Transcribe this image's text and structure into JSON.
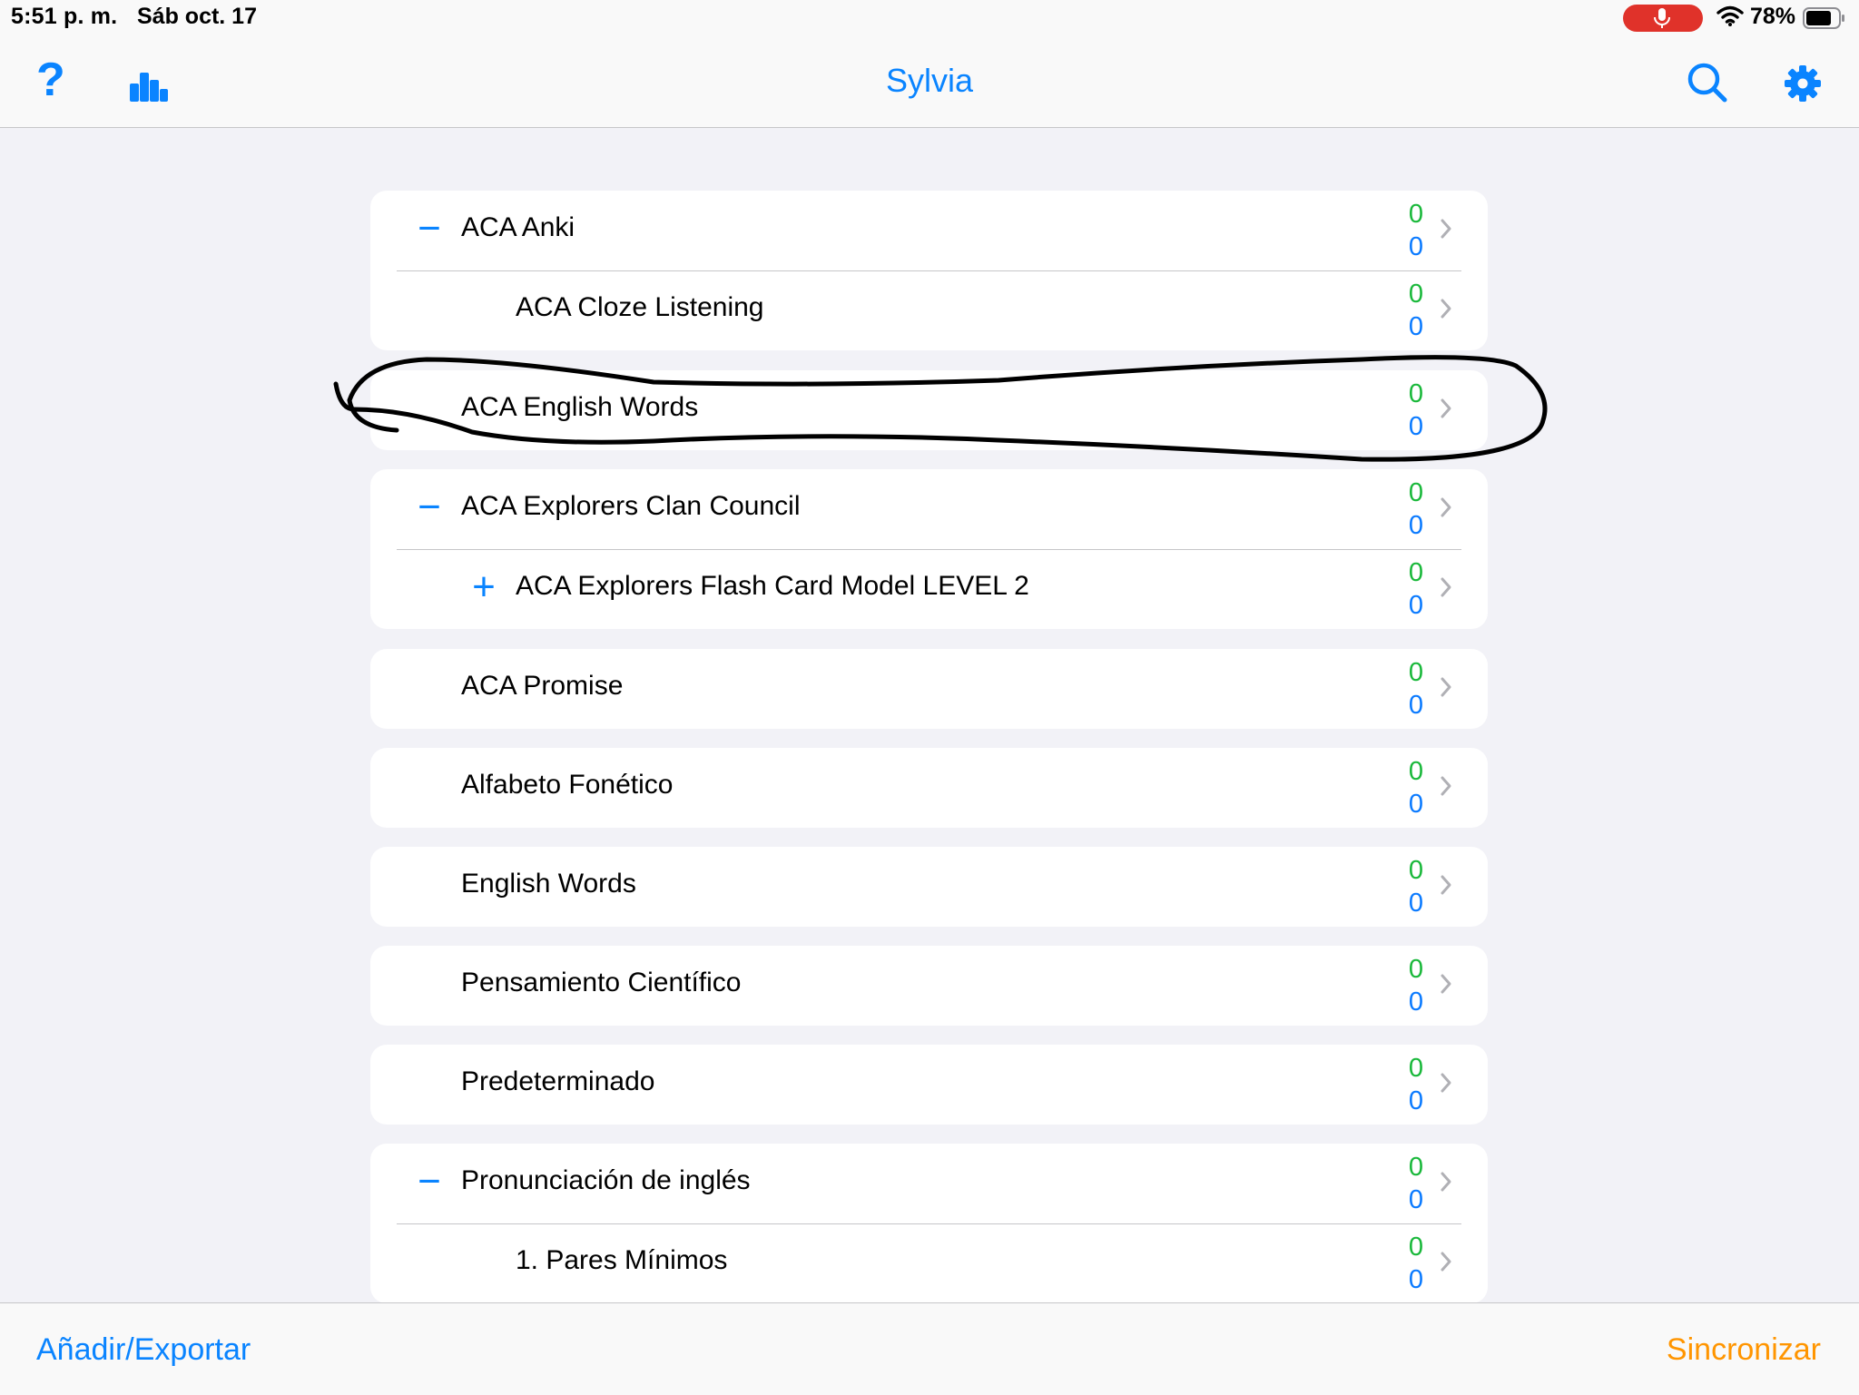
{
  "status_bar": {
    "time": "5:51 p. m.",
    "date": "Sáb oct. 17",
    "battery": "78%",
    "icons": [
      "microphone-icon",
      "wifi-icon",
      "battery-icon"
    ]
  },
  "nav": {
    "title": "Sylvia",
    "help_icon": "?",
    "icons": [
      "help-icon",
      "stats-icon",
      "search-icon",
      "gear-icon"
    ]
  },
  "colors": {
    "accent": "#0a84ff",
    "new_count": "#19b83a",
    "due_count": "#0a7aff",
    "sync": "#ff9500",
    "background": "#f2f2f7"
  },
  "decks": [
    {
      "rows": [
        {
          "name": "ACA Anki",
          "toggle": "−",
          "level": 0,
          "new": "0",
          "due": "0"
        },
        {
          "name": "ACA Cloze Listening",
          "toggle": "",
          "level": 1,
          "new": "0",
          "due": "0"
        }
      ]
    },
    {
      "rows": [
        {
          "name": "ACA English Words",
          "toggle": "",
          "level": 0,
          "new": "0",
          "due": "0"
        }
      ]
    },
    {
      "rows": [
        {
          "name": "ACA Explorers Clan Council",
          "toggle": "−",
          "level": 0,
          "new": "0",
          "due": "0"
        },
        {
          "name": "ACA Explorers Flash Card Model LEVEL 2",
          "toggle": "+",
          "level": 1,
          "new": "0",
          "due": "0"
        }
      ]
    },
    {
      "rows": [
        {
          "name": "ACA Promise",
          "toggle": "",
          "level": 0,
          "new": "0",
          "due": "0"
        }
      ]
    },
    {
      "rows": [
        {
          "name": "Alfabeto Fonético",
          "toggle": "",
          "level": 0,
          "new": "0",
          "due": "0"
        }
      ]
    },
    {
      "rows": [
        {
          "name": "English Words",
          "toggle": "",
          "level": 0,
          "new": "0",
          "due": "0"
        }
      ]
    },
    {
      "rows": [
        {
          "name": "Pensamiento Científico",
          "toggle": "",
          "level": 0,
          "new": "0",
          "due": "0"
        }
      ]
    },
    {
      "rows": [
        {
          "name": "Predeterminado",
          "toggle": "",
          "level": 0,
          "new": "0",
          "due": "0"
        }
      ]
    },
    {
      "rows": [
        {
          "name": "Pronunciación de inglés",
          "toggle": "−",
          "level": 0,
          "new": "0",
          "due": "0"
        },
        {
          "name": "1. Pares Mínimos",
          "toggle": "",
          "level": 1,
          "new": "0",
          "due": "0"
        }
      ]
    }
  ],
  "toolbar": {
    "add_export_label": "Añadir/Exportar",
    "sync_label": "Sincronizar"
  }
}
